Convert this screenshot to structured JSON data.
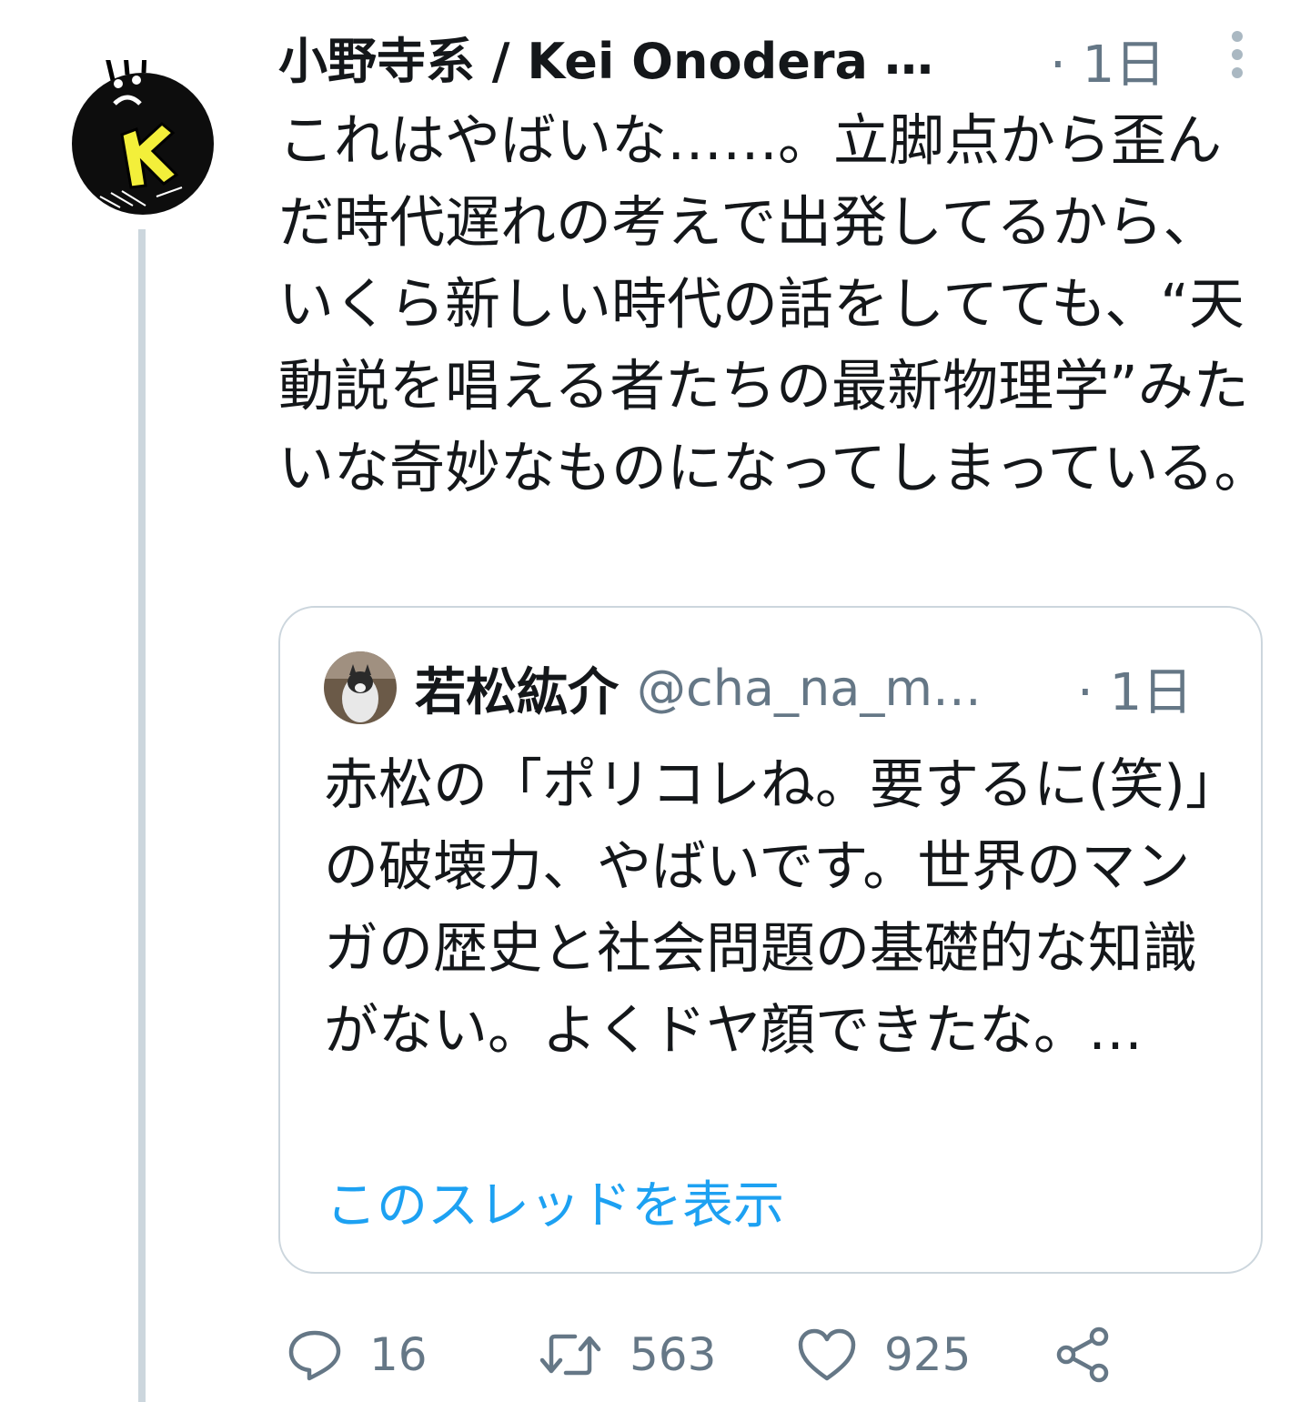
{
  "tweet": {
    "display_name": "小野寺系 / Kei Onodera",
    "time": "· 1日",
    "text": "これはやばいな……。立脚点から歪んだ時代遅れの考えで出発してるから、いくら新しい時代の話をしてても、“天動説を唱える者たちの最新物理学”みたいな奇妙なものになってしまっている。",
    "avatar_icon": "k-character-avatar-icon",
    "more_icon": "vertical-dots-icon"
  },
  "quote": {
    "display_name": "若松紘介",
    "handle": "@cha_na_m…",
    "time": "· 1日",
    "text": "赤松の「ポリコレね。要するに(笑)」の破壊力、やばいです。世界のマンガの歴史と社会問題の基礎的な知識がない。よくドヤ顔できたな。…",
    "show_thread": "このスレッドを表示",
    "avatar_icon": "cat-photo-avatar-icon"
  },
  "actions": {
    "reply_count": "16",
    "retweet_count": "563",
    "like_count": "925",
    "reply_icon": "reply-icon",
    "retweet_icon": "retweet-icon",
    "like_icon": "heart-icon",
    "share_icon": "share-icon"
  },
  "colors": {
    "text_primary": "#14171a",
    "text_secondary": "#657786",
    "link": "#1da1f2",
    "border": "#ccd6dd"
  }
}
